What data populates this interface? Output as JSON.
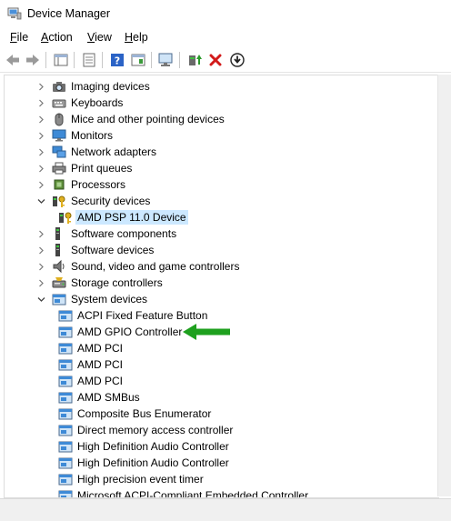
{
  "window": {
    "title": "Device Manager"
  },
  "menu": [
    {
      "label": "File",
      "accel": "F",
      "rest": "ile"
    },
    {
      "label": "Action",
      "accel": "A",
      "rest": "ction"
    },
    {
      "label": "View",
      "accel": "V",
      "rest": "iew"
    },
    {
      "label": "Help",
      "accel": "H",
      "rest": "elp"
    }
  ],
  "toolbar": [
    {
      "name": "back-arrow-icon"
    },
    {
      "name": "forward-arrow-icon"
    },
    {
      "name": "properties-sheet-icon"
    },
    {
      "name": "details-list-icon"
    },
    {
      "name": "help-icon"
    },
    {
      "name": "action-pane-icon"
    },
    {
      "name": "monitor-scan-icon"
    },
    {
      "name": "update-driver-icon"
    },
    {
      "name": "uninstall-x-icon"
    },
    {
      "name": "download-circle-icon"
    }
  ],
  "tree": [
    {
      "label": "Imaging devices",
      "level": 0,
      "expanded": false,
      "icon": "camera-icon"
    },
    {
      "label": "Keyboards",
      "level": 0,
      "expanded": false,
      "icon": "keyboard-icon"
    },
    {
      "label": "Mice and other pointing devices",
      "level": 0,
      "expanded": false,
      "icon": "mouse-icon"
    },
    {
      "label": "Monitors",
      "level": 0,
      "expanded": false,
      "icon": "monitor-icon"
    },
    {
      "label": "Network adapters",
      "level": 0,
      "expanded": false,
      "icon": "network-icon"
    },
    {
      "label": "Print queues",
      "level": 0,
      "expanded": false,
      "icon": "printer-icon"
    },
    {
      "label": "Processors",
      "level": 0,
      "expanded": false,
      "icon": "chip-icon"
    },
    {
      "label": "Security devices",
      "level": 0,
      "expanded": true,
      "icon": "key-icon"
    },
    {
      "label": "AMD PSP 11.0 Device",
      "level": 1,
      "icon": "key-icon",
      "selected": true
    },
    {
      "label": "Software components",
      "level": 0,
      "expanded": false,
      "icon": "software-icon"
    },
    {
      "label": "Software devices",
      "level": 0,
      "expanded": false,
      "icon": "software-icon"
    },
    {
      "label": "Sound, video and game controllers",
      "level": 0,
      "expanded": false,
      "icon": "speaker-icon"
    },
    {
      "label": "Storage controllers",
      "level": 0,
      "expanded": false,
      "icon": "storage-icon"
    },
    {
      "label": "System devices",
      "level": 0,
      "expanded": true,
      "icon": "system-folder-icon"
    },
    {
      "label": "ACPI Fixed Feature Button",
      "level": 1,
      "icon": "system-folder-icon"
    },
    {
      "label": "AMD GPIO Controller",
      "level": 1,
      "icon": "system-folder-icon"
    },
    {
      "label": "AMD PCI",
      "level": 1,
      "icon": "system-folder-icon"
    },
    {
      "label": "AMD PCI",
      "level": 1,
      "icon": "system-folder-icon"
    },
    {
      "label": "AMD PCI",
      "level": 1,
      "icon": "system-folder-icon"
    },
    {
      "label": "AMD SMBus",
      "level": 1,
      "icon": "system-folder-icon"
    },
    {
      "label": "Composite Bus Enumerator",
      "level": 1,
      "icon": "system-folder-icon"
    },
    {
      "label": "Direct memory access controller",
      "level": 1,
      "icon": "system-folder-icon"
    },
    {
      "label": "High Definition Audio Controller",
      "level": 1,
      "icon": "system-folder-icon"
    },
    {
      "label": "High Definition Audio Controller",
      "level": 1,
      "icon": "system-folder-icon"
    },
    {
      "label": "High precision event timer",
      "level": 1,
      "icon": "system-folder-icon"
    },
    {
      "label": "Microsoft ACPI-Compliant Embedded Controller",
      "level": 1,
      "icon": "system-folder-icon"
    }
  ],
  "annotation": {
    "icon": "green-arrow-icon",
    "color": "#1ea01e"
  },
  "colors": {
    "selection": "#cce8ff",
    "accent": "#1e90ff"
  }
}
